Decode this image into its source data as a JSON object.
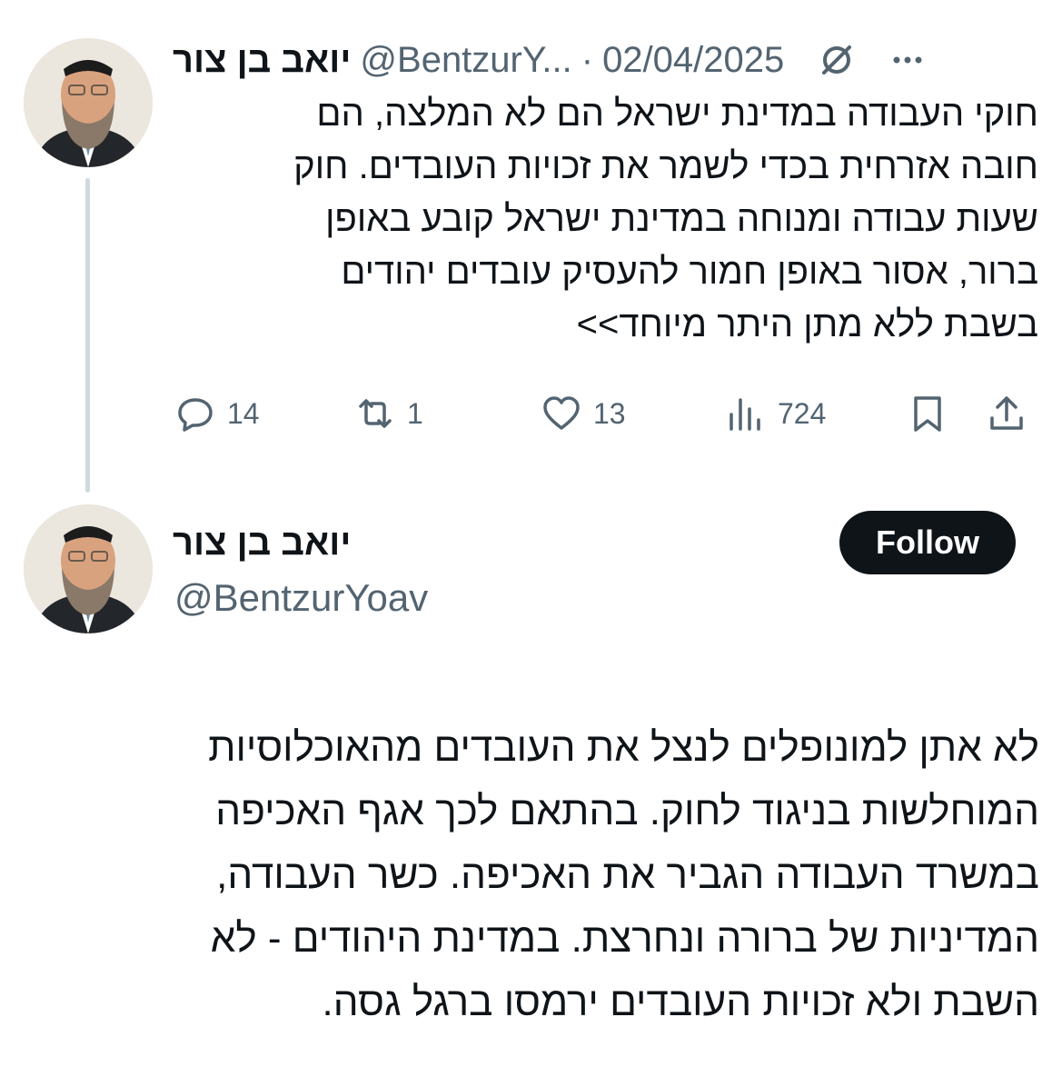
{
  "tweet1": {
    "display_name": "יואב בן צור",
    "handle": "@BentzurY...",
    "separator": "·",
    "date": "02/04/2025",
    "text_lines": [
      "חוקי העבודה במדינת ישראל הם לא המלצה, הם",
      "חובה אזרחית בכדי לשמר את זכויות העובדים. חוק",
      "שעות עבודה ומנוחה במדינת ישראל קובע באופן",
      "ברור, אסור באופן חמור להעסיק עובדים יהודים",
      "בשבת ללא מתן היתר מיוחד>>"
    ],
    "replies": "14",
    "reposts": "1",
    "likes": "13",
    "views": "724"
  },
  "tweet2": {
    "display_name": "יואב בן צור",
    "handle": "@BentzurYoav",
    "follow_label": "Follow",
    "text_lines": [
      "לא אתן למונופלים לנצל את העובדים מהאוכלוסיות",
      "המוחלשות בניגוד לחוק. בהתאם לכך אגף האכיפה",
      "במשרד העבודה הגביר את האכיפה. כשר העבודה,",
      "המדיניות של  ברורה ונחרצת. במדינת היהודים - לא",
      "השבת ולא זכויות העובדים ירמסו ברגל גסה."
    ]
  },
  "colors": {
    "text": "#0f1419",
    "secondary": "#536471",
    "thread_line": "#cfd9de",
    "follow_bg": "#0f1419"
  },
  "icons": [
    "grok-icon",
    "more-icon",
    "reply-icon",
    "repost-icon",
    "like-icon",
    "views-icon",
    "bookmark-icon",
    "share-icon"
  ]
}
